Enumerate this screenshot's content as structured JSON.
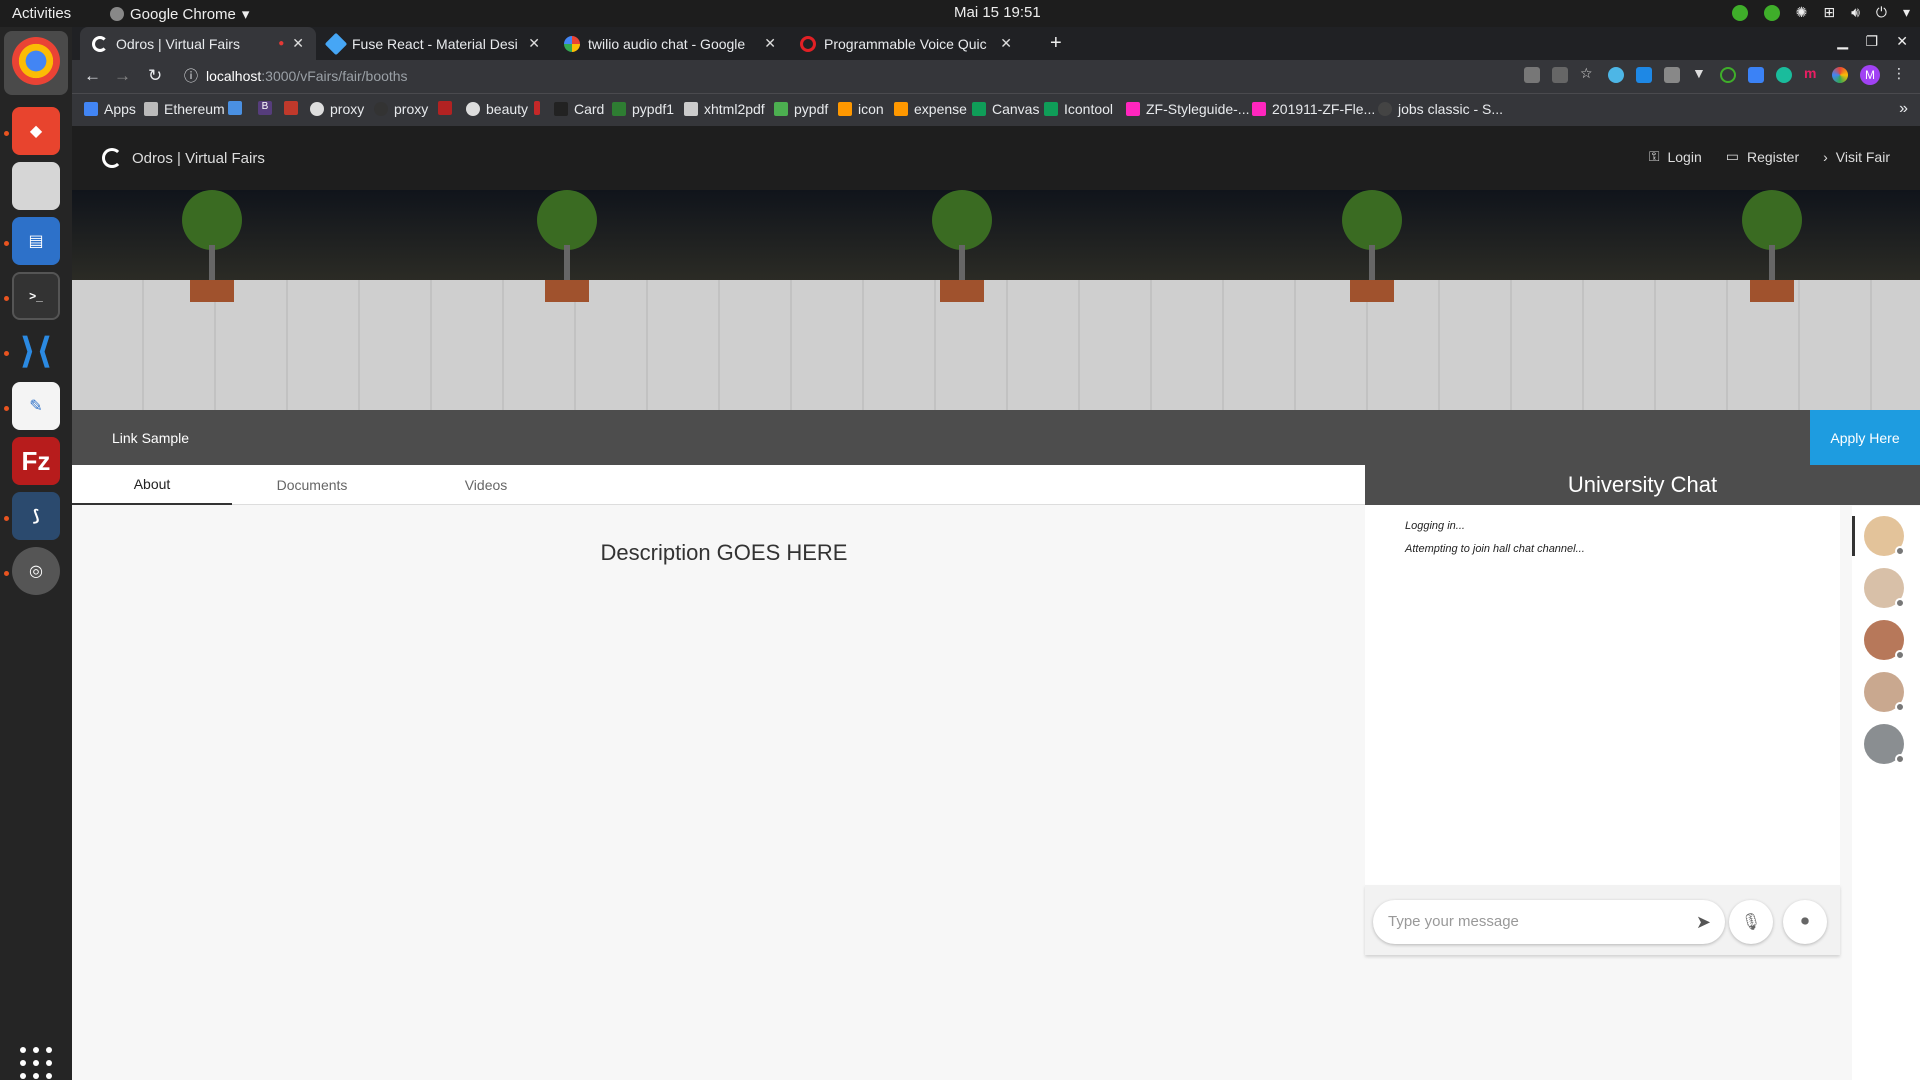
{
  "os": {
    "activities": "Activities",
    "app_name": "Google Chrome",
    "clock": "Mai 15  19:51"
  },
  "browser": {
    "tabs": [
      {
        "title": "Odros | Virtual Fairs",
        "favicon_color": "#ffffff",
        "active": true
      },
      {
        "title": "Fuse React - Material Desi",
        "favicon_color": "#46a6f5",
        "active": false
      },
      {
        "title": "twilio audio chat - Google",
        "favicon_color": "#ffffff",
        "active": false
      },
      {
        "title": "Programmable Voice Quic",
        "favicon_color": "#e22025",
        "active": false
      }
    ],
    "url_host": "localhost",
    "url_path": ":3000/vFairs/fair/booths",
    "profile_initial": "M",
    "bookmarks": [
      {
        "label": "Apps",
        "color": "#4285f4"
      },
      {
        "label": "Ethereum",
        "color": "#bbbbbb"
      },
      {
        "label": "",
        "color": "#4a90e2"
      },
      {
        "label": "B",
        "color": "#563d7c"
      },
      {
        "label": "",
        "color": "#c0392b"
      },
      {
        "label": "proxy",
        "color": "#dddddd"
      },
      {
        "label": "proxy",
        "color": "#333333"
      },
      {
        "label": "",
        "color": "#b22222"
      },
      {
        "label": "beauty",
        "color": "#dddddd"
      },
      {
        "label": "",
        "color": "#c62828"
      },
      {
        "label": "Card",
        "color": "#222222"
      },
      {
        "label": "pypdf1",
        "color": "#2e7d32"
      },
      {
        "label": "xhtml2pdf",
        "color": "#cccccc"
      },
      {
        "label": "pypdf",
        "color": "#4caf50"
      },
      {
        "label": "icon",
        "color": "#ff9800"
      },
      {
        "label": "expense",
        "color": "#ff9800"
      },
      {
        "label": "Canvas",
        "color": "#0f9d58"
      },
      {
        "label": "Icontool",
        "color": "#0f9d58"
      },
      {
        "label": "ZF-Styleguide-...",
        "color": "#ff26be"
      },
      {
        "label": "201911-ZF-Fle...",
        "color": "#ff26be"
      },
      {
        "label": "jobs classic - S...",
        "color": "#444444"
      }
    ]
  },
  "site": {
    "brand": "Odros | Virtual Fairs",
    "nav": {
      "login": "Login",
      "register": "Register",
      "visit": "Visit Fair"
    },
    "subbar_link": "Link Sample",
    "apply_label": "Apply Here",
    "tabs": [
      "About",
      "Documents",
      "Videos"
    ],
    "description": "Description GOES HERE"
  },
  "chat": {
    "title": "University Chat",
    "messages": [
      "Logging in...",
      "Attempting to join hall chat channel..."
    ],
    "input_placeholder": "Type your message"
  }
}
